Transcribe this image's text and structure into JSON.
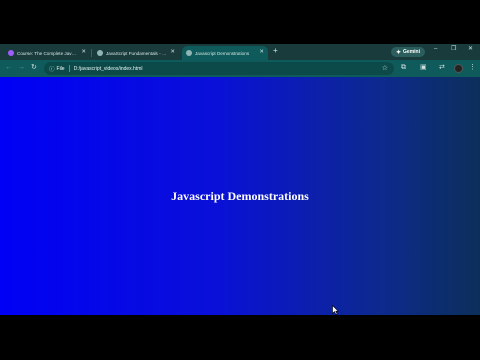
{
  "tabs": [
    {
      "title": "Course: The Complete JavaScript",
      "favicon": "course-icon",
      "active": false,
      "favicon_color": "#a05cff"
    },
    {
      "title": "JavaScript Fundamentals - Part",
      "favicon": "globe-icon",
      "active": false,
      "favicon_color": "#8fb5b5"
    },
    {
      "title": "Javascript Demonstrations",
      "favicon": "globe-icon",
      "active": true,
      "favicon_color": "#8fb5b5"
    }
  ],
  "new_tab_label": "+",
  "gemini_label": "Gemini",
  "address_bar": {
    "scheme_label": "File",
    "url": "D:/javascript_videos/index.html"
  },
  "page": {
    "heading": "Javascript Demonstrations"
  },
  "colors": {
    "tab_strip": "#1a3b3b",
    "toolbar": "#0f5a5a",
    "page_gradient_start": "#0000f5",
    "page_gradient_end": "#0c2f5a"
  }
}
